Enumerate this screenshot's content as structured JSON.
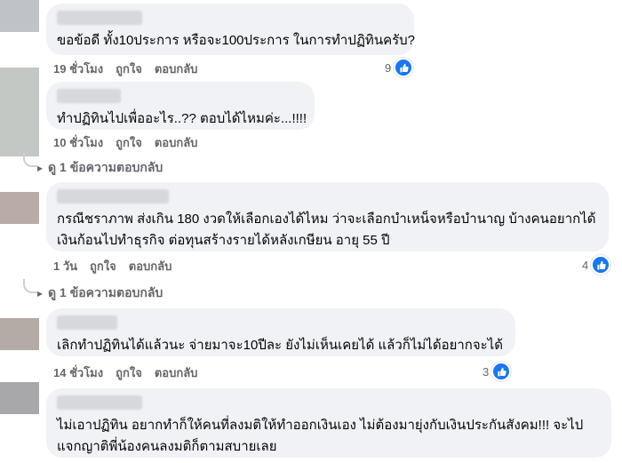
{
  "comments": [
    {
      "text_lines": [
        "ขอข้อดี ทั้ง10ประการ หรือจะ100ประการ ในการทำปฏิทินครับ?"
      ],
      "time": "19 ชั่วโมง",
      "like_label": "ถูกใจ",
      "reply_label": "ตอบกลับ",
      "reaction_count": "9"
    },
    {
      "text_lines": [
        "ทำปฏิทินไปเพื่ออะไร..?? ตอบได้ไหมค่ะ...!!!!"
      ],
      "time": "10 ชั่วโมง",
      "like_label": "ถูกใจ",
      "reply_label": "ตอบกลับ",
      "reaction_count": "",
      "more_replies": "ดู 1 ข้อความตอบกลับ"
    },
    {
      "text_lines": [
        "กรณีชราภาพ ส่งเกิน 180 งวดให้เลือกเองได้ไหม ว่าจะเลือกบำเหน็จหรือบำนาญ บ้างคนอยากได้",
        "เงินก้อนไปทำธุรกิจ ต่อทุนสร้างรายได้หลังเกษียน อายุ 55 ปี"
      ],
      "time": "1 วัน",
      "like_label": "ถูกใจ",
      "reply_label": "ตอบกลับ",
      "reaction_count": "4",
      "more_replies": "ดู 1 ข้อความตอบกลับ"
    },
    {
      "text_lines": [
        "เลิกทำปฏิทินได้แล้วนะ จ่ายมาจะ10ปีละ ยังไม่เห็นเคยได้ แล้วก็ไม่ได้อยากจะได้"
      ],
      "time": "14 ชั่วโมง",
      "like_label": "ถูกใจ",
      "reply_label": "ตอบกลับ",
      "reaction_count": "3"
    },
    {
      "text_lines": [
        "ไม่เอาปฏิทิน อยากทำก็ให้คนที่ลงมติให้ทำออกเงินเอง ไม่ต้องมายุ่งกับเงินประกันสังคม!!! จะไป",
        "แจกญาติพี่น้องคนลงมติก็ตามสบายเลย"
      ],
      "time": "",
      "like_label": "",
      "reply_label": "",
      "reaction_count": ""
    }
  ],
  "colors": {
    "bubble": "#f0f2f5",
    "like_blue": "#1877f2",
    "meta_grey": "#65676b"
  }
}
